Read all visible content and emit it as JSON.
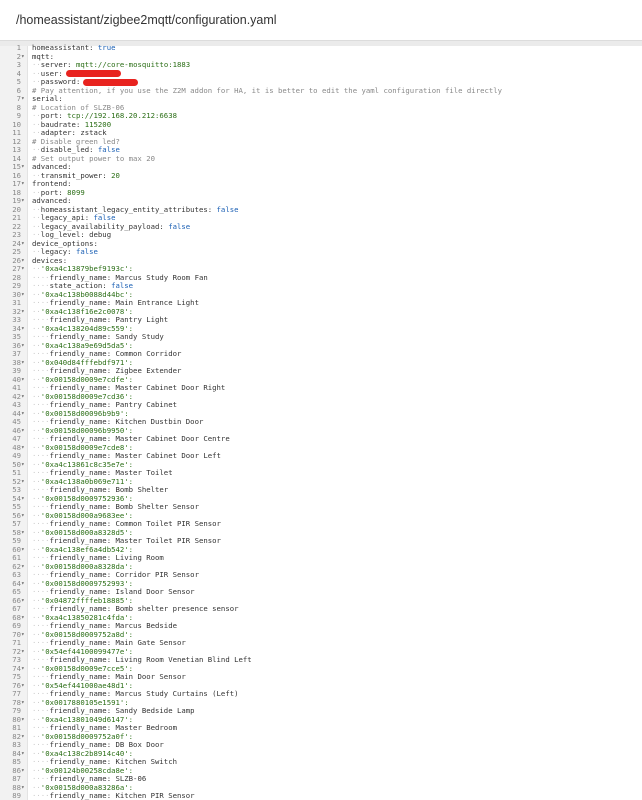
{
  "header": {
    "path": "/homeassistant/zigbee2mqtt/configuration.yaml"
  },
  "lines": [
    {
      "n": "1",
      "f": "",
      "i": 0,
      "k": "homeassistant:",
      "v": "true",
      "t": "b"
    },
    {
      "n": "2",
      "f": "▾",
      "i": 0,
      "k": "mqtt:",
      "v": "",
      "t": ""
    },
    {
      "n": "3",
      "f": "",
      "i": 2,
      "k": "server:",
      "v": "mqtt://core-mosquitto:1883",
      "t": "s"
    },
    {
      "n": "4",
      "f": "",
      "i": 2,
      "k": "user:",
      "v": "",
      "t": "r"
    },
    {
      "n": "5",
      "f": "",
      "i": 2,
      "k": "password:",
      "v": "",
      "t": "r"
    },
    {
      "n": "6",
      "f": "",
      "i": 0,
      "k": "",
      "v": "# Pay attention, if you use the Z2M addon for HA, it is better to edit the yaml configuration file directly",
      "t": "c"
    },
    {
      "n": "7",
      "f": "▾",
      "i": 0,
      "k": "serial:",
      "v": "",
      "t": ""
    },
    {
      "n": "8",
      "f": "",
      "i": 0,
      "k": "",
      "v": "# Location of SLZB-06",
      "t": "c"
    },
    {
      "n": "9",
      "f": "",
      "i": 2,
      "k": "port:",
      "v": "tcp://192.168.20.212:6638",
      "t": "s"
    },
    {
      "n": "10",
      "f": "",
      "i": 2,
      "k": "baudrate:",
      "v": "115200",
      "t": "n"
    },
    {
      "n": "11",
      "f": "",
      "i": 2,
      "k": "adapter:",
      "v": "zstack",
      "t": "k"
    },
    {
      "n": "12",
      "f": "",
      "i": 0,
      "k": "",
      "v": "# Disable green led?",
      "t": "c"
    },
    {
      "n": "13",
      "f": "",
      "i": 2,
      "k": "disable_led:",
      "v": "false",
      "t": "b"
    },
    {
      "n": "14",
      "f": "",
      "i": 0,
      "k": "",
      "v": "# Set output power to max 20",
      "t": "c"
    },
    {
      "n": "15",
      "f": "▾",
      "i": 0,
      "k": "advanced:",
      "v": "",
      "t": ""
    },
    {
      "n": "16",
      "f": "",
      "i": 2,
      "k": "transmit_power:",
      "v": "20",
      "t": "n"
    },
    {
      "n": "17",
      "f": "▾",
      "i": 0,
      "k": "frontend:",
      "v": "",
      "t": ""
    },
    {
      "n": "18",
      "f": "",
      "i": 2,
      "k": "port:",
      "v": "8099",
      "t": "n"
    },
    {
      "n": "19",
      "f": "▾",
      "i": 0,
      "k": "advanced:",
      "v": "",
      "t": ""
    },
    {
      "n": "20",
      "f": "",
      "i": 2,
      "k": "homeassistant_legacy_entity_attributes:",
      "v": "false",
      "t": "b"
    },
    {
      "n": "21",
      "f": "",
      "i": 2,
      "k": "legacy_api:",
      "v": "false",
      "t": "b"
    },
    {
      "n": "22",
      "f": "",
      "i": 2,
      "k": "legacy_availability_payload:",
      "v": "false",
      "t": "b"
    },
    {
      "n": "23",
      "f": "",
      "i": 2,
      "k": "log_level:",
      "v": "debug",
      "t": "k"
    },
    {
      "n": "24",
      "f": "▾",
      "i": 0,
      "k": "device_options:",
      "v": "",
      "t": ""
    },
    {
      "n": "25",
      "f": "",
      "i": 2,
      "k": "legacy:",
      "v": "false",
      "t": "b"
    },
    {
      "n": "26",
      "f": "▾",
      "i": 0,
      "k": "devices:",
      "v": "",
      "t": ""
    },
    {
      "n": "27",
      "f": "▾",
      "i": 2,
      "k": "",
      "v": "'0xa4c13879bef9193c':",
      "t": "s"
    },
    {
      "n": "28",
      "f": "",
      "i": 4,
      "k": "friendly_name:",
      "v": "Marcus Study Room Fan",
      "t": "k"
    },
    {
      "n": "29",
      "f": "",
      "i": 4,
      "k": "state_action:",
      "v": "false",
      "t": "b"
    },
    {
      "n": "30",
      "f": "▾",
      "i": 2,
      "k": "",
      "v": "'0xa4c138b0088d44bc':",
      "t": "s"
    },
    {
      "n": "31",
      "f": "",
      "i": 4,
      "k": "friendly_name:",
      "v": "Main Entrance Light",
      "t": "k"
    },
    {
      "n": "32",
      "f": "▾",
      "i": 2,
      "k": "",
      "v": "'0xa4c138f16e2c0078':",
      "t": "s"
    },
    {
      "n": "33",
      "f": "",
      "i": 4,
      "k": "friendly_name:",
      "v": "Pantry Light",
      "t": "k"
    },
    {
      "n": "34",
      "f": "▾",
      "i": 2,
      "k": "",
      "v": "'0xa4c138204d89c559':",
      "t": "s"
    },
    {
      "n": "35",
      "f": "",
      "i": 4,
      "k": "friendly_name:",
      "v": "Sandy Study",
      "t": "k"
    },
    {
      "n": "36",
      "f": "▾",
      "i": 2,
      "k": "",
      "v": "'0xa4c138a9e69d5da5':",
      "t": "s"
    },
    {
      "n": "37",
      "f": "",
      "i": 4,
      "k": "friendly_name:",
      "v": "Common Corridor",
      "t": "k"
    },
    {
      "n": "38",
      "f": "▾",
      "i": 2,
      "k": "",
      "v": "'0x040d84fffebdf971':",
      "t": "s"
    },
    {
      "n": "39",
      "f": "",
      "i": 4,
      "k": "friendly_name:",
      "v": "Zigbee Extender",
      "t": "k"
    },
    {
      "n": "40",
      "f": "▾",
      "i": 2,
      "k": "",
      "v": "'0x00158d0009e7cdfe':",
      "t": "s"
    },
    {
      "n": "41",
      "f": "",
      "i": 4,
      "k": "friendly_name:",
      "v": "Master Cabinet Door Right",
      "t": "k"
    },
    {
      "n": "42",
      "f": "▾",
      "i": 2,
      "k": "",
      "v": "'0x00158d0009e7cd36':",
      "t": "s"
    },
    {
      "n": "43",
      "f": "",
      "i": 4,
      "k": "friendly_name:",
      "v": "Pantry Cabinet",
      "t": "k"
    },
    {
      "n": "44",
      "f": "▾",
      "i": 2,
      "k": "",
      "v": "'0x00158d00096b9b9':",
      "t": "s"
    },
    {
      "n": "45",
      "f": "",
      "i": 4,
      "k": "friendly_name:",
      "v": "Kitchen Dustbin Door",
      "t": "k"
    },
    {
      "n": "46",
      "f": "▾",
      "i": 2,
      "k": "",
      "v": "'0x00158d00096b9950':",
      "t": "s"
    },
    {
      "n": "47",
      "f": "",
      "i": 4,
      "k": "friendly_name:",
      "v": "Master Cabinet Door Centre",
      "t": "k"
    },
    {
      "n": "48",
      "f": "▾",
      "i": 2,
      "k": "",
      "v": "'0x00158d0009e7cde8':",
      "t": "s"
    },
    {
      "n": "49",
      "f": "",
      "i": 4,
      "k": "friendly_name:",
      "v": "Master Cabinet Door Left",
      "t": "k"
    },
    {
      "n": "50",
      "f": "▾",
      "i": 2,
      "k": "",
      "v": "'0xa4c13861c8c35e7e':",
      "t": "s"
    },
    {
      "n": "51",
      "f": "",
      "i": 4,
      "k": "friendly_name:",
      "v": "Master Toilet",
      "t": "k"
    },
    {
      "n": "52",
      "f": "▾",
      "i": 2,
      "k": "",
      "v": "'0xa4c138a0b069e711':",
      "t": "s"
    },
    {
      "n": "53",
      "f": "",
      "i": 4,
      "k": "friendly_name:",
      "v": "Bomb Shelter",
      "t": "k"
    },
    {
      "n": "54",
      "f": "▾",
      "i": 2,
      "k": "",
      "v": "'0x00158d0009752936':",
      "t": "s"
    },
    {
      "n": "55",
      "f": "",
      "i": 4,
      "k": "friendly_name:",
      "v": "Bomb Shelter Sensor",
      "t": "k"
    },
    {
      "n": "56",
      "f": "▾",
      "i": 2,
      "k": "",
      "v": "'0x00158d000a9683ee':",
      "t": "s"
    },
    {
      "n": "57",
      "f": "",
      "i": 4,
      "k": "friendly_name:",
      "v": "Common Toilet PIR Sensor",
      "t": "k"
    },
    {
      "n": "58",
      "f": "▾",
      "i": 2,
      "k": "",
      "v": "'0x00158d000a8328d5':",
      "t": "s"
    },
    {
      "n": "59",
      "f": "",
      "i": 4,
      "k": "friendly_name:",
      "v": "Master Toilet PIR Sensor",
      "t": "k"
    },
    {
      "n": "60",
      "f": "▾",
      "i": 2,
      "k": "",
      "v": "'0xa4c138ef6a4db542':",
      "t": "s"
    },
    {
      "n": "61",
      "f": "",
      "i": 4,
      "k": "friendly_name:",
      "v": "Living Room",
      "t": "k"
    },
    {
      "n": "62",
      "f": "▾",
      "i": 2,
      "k": "",
      "v": "'0x00158d000a8328da':",
      "t": "s"
    },
    {
      "n": "63",
      "f": "",
      "i": 4,
      "k": "friendly_name:",
      "v": "Corridor PIR Sensor",
      "t": "k"
    },
    {
      "n": "64",
      "f": "▾",
      "i": 2,
      "k": "",
      "v": "'0x00158d0009752993':",
      "t": "s"
    },
    {
      "n": "65",
      "f": "",
      "i": 4,
      "k": "friendly_name:",
      "v": "Island Door Sensor",
      "t": "k"
    },
    {
      "n": "66",
      "f": "▾",
      "i": 2,
      "k": "",
      "v": "'0x04872ffffeb18885':",
      "t": "s"
    },
    {
      "n": "67",
      "f": "",
      "i": 4,
      "k": "friendly_name:",
      "v": "Bomb shelter presence sensor",
      "t": "k"
    },
    {
      "n": "68",
      "f": "▾",
      "i": 2,
      "k": "",
      "v": "'0xa4c13850281c4fda':",
      "t": "s"
    },
    {
      "n": "69",
      "f": "",
      "i": 4,
      "k": "friendly_name:",
      "v": "Marcus Bedside",
      "t": "k"
    },
    {
      "n": "70",
      "f": "▾",
      "i": 2,
      "k": "",
      "v": "'0x00158d0009752a8d':",
      "t": "s"
    },
    {
      "n": "71",
      "f": "",
      "i": 4,
      "k": "friendly_name:",
      "v": "Main Gate Sensor",
      "t": "k"
    },
    {
      "n": "72",
      "f": "▾",
      "i": 2,
      "k": "",
      "v": "'0x54ef44100099477e':",
      "t": "s"
    },
    {
      "n": "73",
      "f": "",
      "i": 4,
      "k": "friendly_name:",
      "v": "Living Room Venetian Blind Left",
      "t": "k"
    },
    {
      "n": "74",
      "f": "▾",
      "i": 2,
      "k": "",
      "v": "'0x00158d0009e7cce5':",
      "t": "s"
    },
    {
      "n": "75",
      "f": "",
      "i": 4,
      "k": "friendly_name:",
      "v": "Main Door Sensor",
      "t": "k"
    },
    {
      "n": "76",
      "f": "▾",
      "i": 2,
      "k": "",
      "v": "'0x54ef441000ae48d1':",
      "t": "s"
    },
    {
      "n": "77",
      "f": "",
      "i": 4,
      "k": "friendly_name:",
      "v": "Marcus Study Curtains (Left)",
      "t": "k"
    },
    {
      "n": "78",
      "f": "▾",
      "i": 2,
      "k": "",
      "v": "'0x0017880105e1591':",
      "t": "s"
    },
    {
      "n": "79",
      "f": "",
      "i": 4,
      "k": "friendly_name:",
      "v": "Sandy Bedside Lamp",
      "t": "k"
    },
    {
      "n": "80",
      "f": "▾",
      "i": 2,
      "k": "",
      "v": "'0xa4c13801049d6147':",
      "t": "s"
    },
    {
      "n": "81",
      "f": "",
      "i": 4,
      "k": "friendly_name:",
      "v": "Master Bedroom",
      "t": "k"
    },
    {
      "n": "82",
      "f": "▾",
      "i": 2,
      "k": "",
      "v": "'0x00158d0009752a0f':",
      "t": "s"
    },
    {
      "n": "83",
      "f": "",
      "i": 4,
      "k": "friendly_name:",
      "v": "DB Box Door",
      "t": "k"
    },
    {
      "n": "84",
      "f": "▾",
      "i": 2,
      "k": "",
      "v": "'0xa4c138c2b8914c40':",
      "t": "s"
    },
    {
      "n": "85",
      "f": "",
      "i": 4,
      "k": "friendly_name:",
      "v": "Kitchen Switch",
      "t": "k"
    },
    {
      "n": "86",
      "f": "▾",
      "i": 2,
      "k": "",
      "v": "'0x00124b00258cda8e':",
      "t": "s"
    },
    {
      "n": "87",
      "f": "",
      "i": 4,
      "k": "friendly_name:",
      "v": "SLZB-06",
      "t": "k"
    },
    {
      "n": "88",
      "f": "▾",
      "i": 2,
      "k": "",
      "v": "'0x00158d000a83286a':",
      "t": "s"
    },
    {
      "n": "89",
      "f": "",
      "i": 4,
      "k": "friendly_name:",
      "v": "Kitchen PIR Sensor",
      "t": "k"
    }
  ]
}
